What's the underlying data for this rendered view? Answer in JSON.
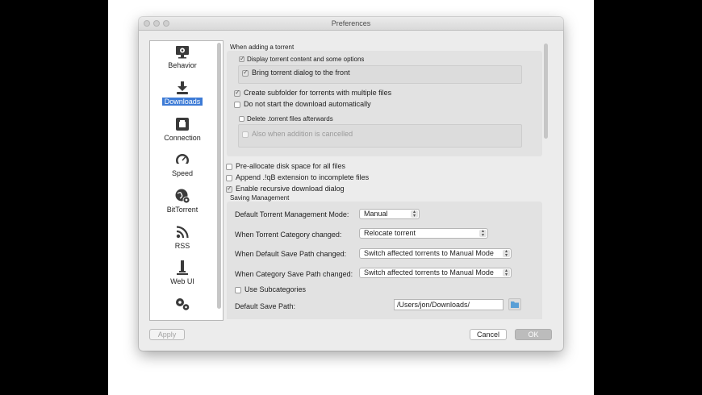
{
  "window": {
    "title": "Preferences"
  },
  "sidebar": {
    "items": [
      {
        "label": "Behavior",
        "icon": "monitor-gear-icon"
      },
      {
        "label": "Downloads",
        "icon": "download-icon",
        "active": true
      },
      {
        "label": "Connection",
        "icon": "network-port-icon"
      },
      {
        "label": "Speed",
        "icon": "speedometer-icon"
      },
      {
        "label": "BitTorrent",
        "icon": "globe-gear-icon"
      },
      {
        "label": "RSS",
        "icon": "rss-icon"
      },
      {
        "label": "Web UI",
        "icon": "web-ui-icon"
      },
      {
        "label": "",
        "icon": "gears-icon"
      }
    ]
  },
  "adding": {
    "section_title": "When adding a torrent",
    "display_content": {
      "label": "Display torrent content and some options",
      "checked": true
    },
    "bring_front": {
      "label": "Bring torrent dialog to the front",
      "checked": true
    },
    "create_subfolder": {
      "label": "Create subfolder for torrents with multiple files",
      "checked": true
    },
    "no_auto_start": {
      "label": "Do not start the download automatically",
      "checked": false
    },
    "delete_torrent": {
      "label": "Delete .torrent files afterwards",
      "checked": false
    },
    "also_cancelled": {
      "label": "Also when addition is cancelled",
      "checked": false,
      "disabled": true
    }
  },
  "options": {
    "preallocate": {
      "label": "Pre-allocate disk space for all files",
      "checked": false
    },
    "append_ext": {
      "label": "Append .!qB extension to incomplete files",
      "checked": false
    },
    "recursive": {
      "label": "Enable recursive download dialog",
      "checked": true
    }
  },
  "saving": {
    "section_title": "Saving Management",
    "mode": {
      "label": "Default Torrent Management Mode:",
      "value": "Manual"
    },
    "category_changed": {
      "label": "When Torrent Category changed:",
      "value": "Relocate torrent"
    },
    "default_path_changed": {
      "label": "When Default Save Path changed:",
      "value": "Switch affected torrents to Manual Mode"
    },
    "category_path_changed": {
      "label": "When Category Save Path changed:",
      "value": "Switch affected torrents to Manual Mode"
    },
    "subcategories": {
      "label": "Use Subcategories",
      "checked": false
    },
    "default_save_path": {
      "label": "Default Save Path:",
      "value": "/Users/jon/Downloads/"
    }
  },
  "buttons": {
    "apply": "Apply",
    "cancel": "Cancel",
    "ok": "OK"
  }
}
